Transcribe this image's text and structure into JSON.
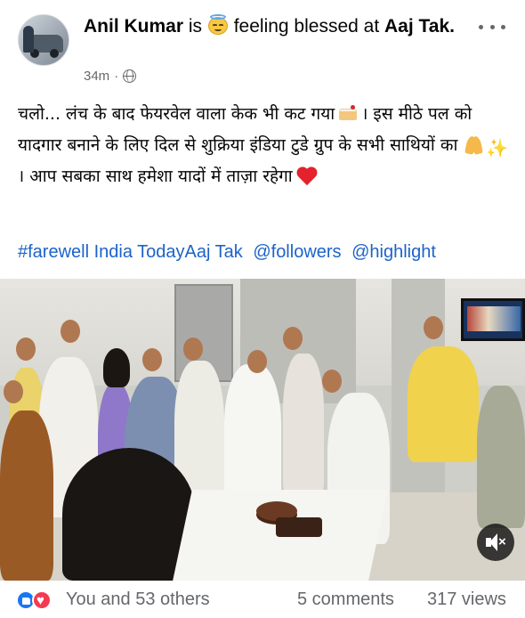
{
  "post": {
    "author": "Anil Kumar",
    "is_word": "is",
    "feeling_emoji": "innocent-face-icon",
    "feeling_text": "feeling blessed at",
    "place": "Aaj Tak.",
    "time": "34m",
    "dot": "·",
    "privacy_icon": "globe-icon",
    "text_lines": {
      "part1": "चलो... लंच के बाद फेयरवेल वाला केक भी कट गया",
      "part2": "। इस मीठे पल को यादगार बनाने के लिए दिल से शुक्रिया इंडिया टुडे ग्रुप के सभी साथियों का",
      "part3": "। आप सबका साथ हमेशा यादों में ताज़ा रहेगा"
    },
    "tags": [
      "#farewell India TodayAaj Tak",
      "@followers",
      "@highlight"
    ]
  },
  "media": {
    "description_icon": "photo-video",
    "mute_icon": "speaker-muted-icon"
  },
  "footer": {
    "reactions_text": "You and 53 others",
    "comments": "5 comments",
    "views": "317 views"
  },
  "colors": {
    "link": "#1c63c9",
    "secondary_text": "#65676b",
    "like_blue": "#1877f2",
    "love_red": "#f23b52"
  }
}
